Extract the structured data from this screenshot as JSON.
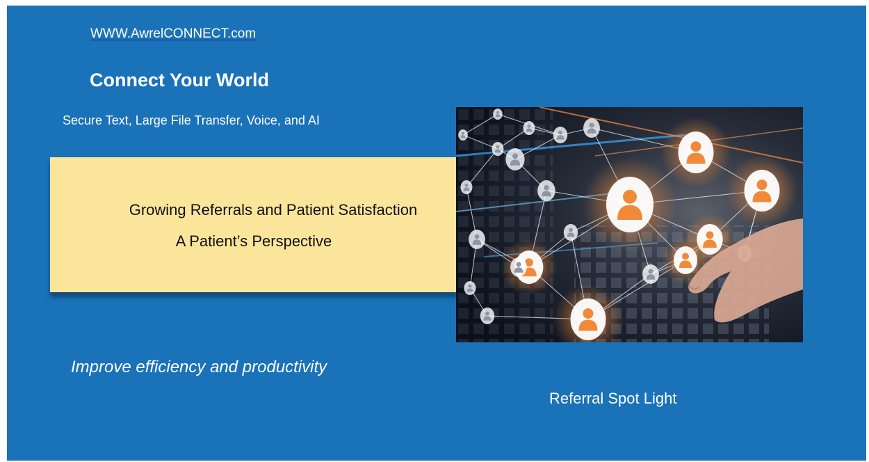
{
  "slide": {
    "url": "WWW.AwrelCONNECT.com",
    "headline": "Connect Your World",
    "subheadline": "Secure Text, Large File Transfer, Voice, and AI",
    "callout": {
      "line1": "Growing Referrals and Patient Satisfaction",
      "line2": "A Patient’s Perspective"
    },
    "tagline": "Improve efficiency and productivity",
    "footer_label": "Referral Spot Light",
    "hero_image": "network-of-people-icons-with-hand-photo"
  },
  "colors": {
    "slide_background": "#1a72b9",
    "callout_background": "#fbe59b",
    "hero_glow": "#f08a3a"
  }
}
